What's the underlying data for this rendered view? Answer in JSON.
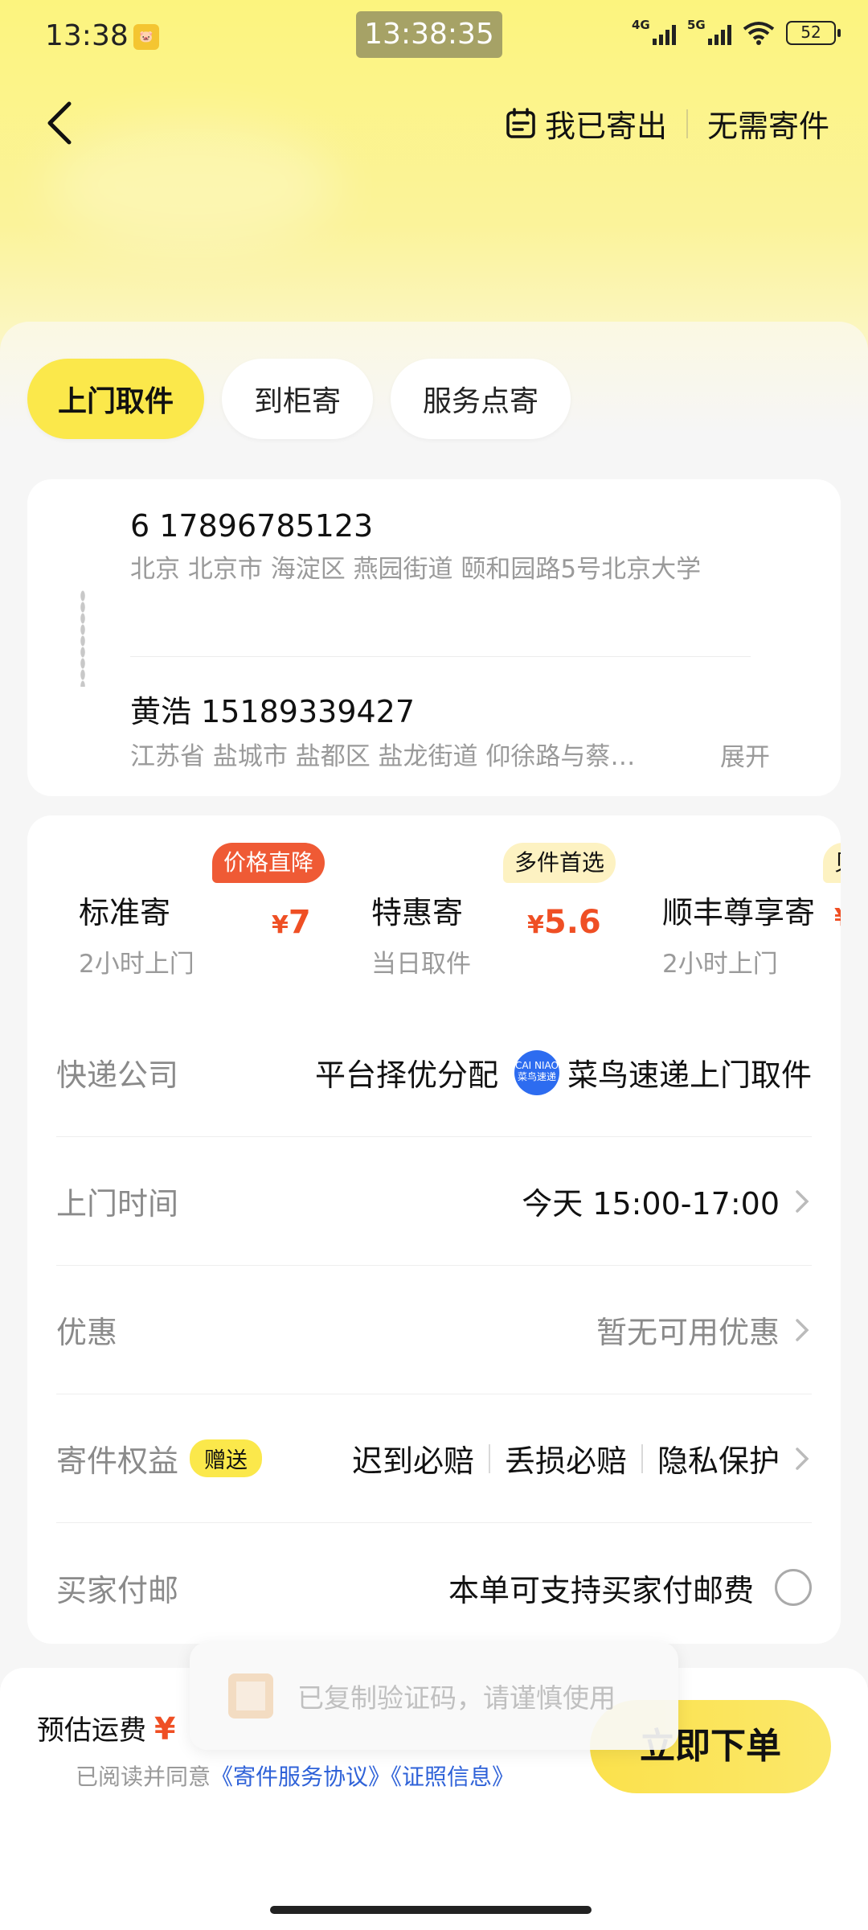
{
  "status_bar": {
    "time": "13:38",
    "app_badge": "🐷",
    "clock_overlay": "13:38:35",
    "network1": "4G",
    "network2": "5G",
    "battery": "52"
  },
  "header": {
    "sent_label": "我已寄出",
    "no_need_label": "无需寄件"
  },
  "tabs": [
    {
      "label": "上门取件",
      "active": true
    },
    {
      "label": "到柜寄",
      "active": false
    },
    {
      "label": "服务点寄",
      "active": false
    }
  ],
  "sender": {
    "name_phone": "6 17896785123",
    "address": "北京 北京市 海淀区 燕园街道 颐和园路5号北京大学"
  },
  "receiver": {
    "name_phone": "黄浩 15189339427",
    "address": "江苏省 盐城市 盐都区 盐龙街道 仰徐路与蔡…",
    "expand_label": "展开"
  },
  "options": [
    {
      "title": "标准寄",
      "subtitle": "2小时上门",
      "currency": "¥",
      "price": "7",
      "badge": "价格直降"
    },
    {
      "title": "特惠寄",
      "subtitle": "当日取件",
      "currency": "¥",
      "price": "5.6",
      "badge": "多件首选"
    },
    {
      "title": "顺丰尊享寄",
      "subtitle": "2小时上门",
      "currency": "¥",
      "price": "",
      "badge": "贝"
    }
  ],
  "rows": {
    "courier": {
      "label": "快递公司",
      "value1": "平台择优分配",
      "logo_text": "CAI NIAO 菜鸟速递",
      "value2": "菜鸟速递上门取件"
    },
    "pickup_time": {
      "label": "上门时间",
      "value": "今天 15:00-17:00"
    },
    "discount": {
      "label": "优惠",
      "value": "暂无可用优惠"
    },
    "benefits": {
      "label": "寄件权益",
      "gift": "赠送",
      "items": [
        "迟到必赔",
        "丢损必赔",
        "隐私保护"
      ]
    },
    "buyer_pay": {
      "label": "买家付邮",
      "value": "本单可支持买家付邮费"
    }
  },
  "bottom": {
    "estimate_label": "预估运费",
    "estimate_currency": "¥",
    "agree_prefix": "已阅读并同意",
    "agreement1": "《寄件服务协议》",
    "agreement2": "《证照信息》",
    "order_button": "立即下单"
  },
  "toast": {
    "text": "已复制验证码，请谨慎使用"
  }
}
